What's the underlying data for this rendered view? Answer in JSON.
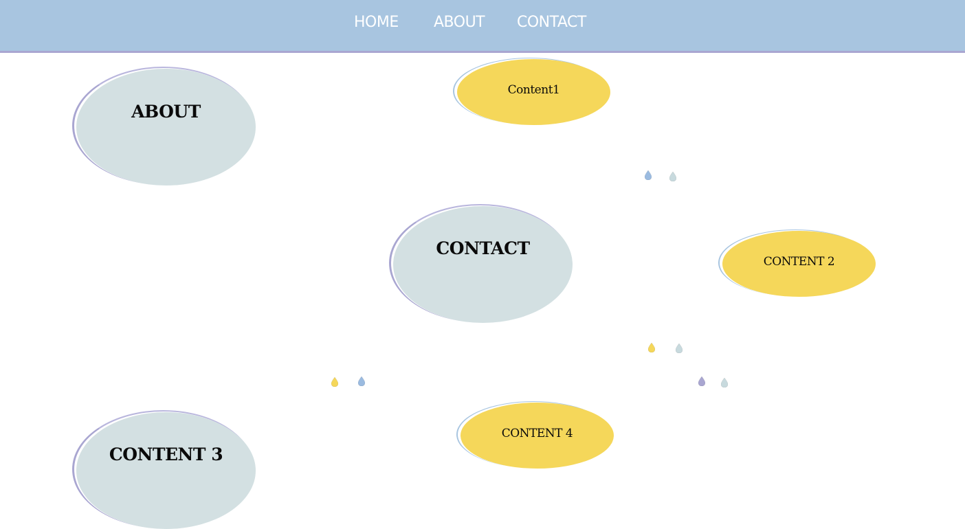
{
  "nav": {
    "items": [
      {
        "label": "HOME"
      },
      {
        "label": "ABOUT"
      },
      {
        "label": "CONTACT"
      }
    ]
  },
  "sections": {
    "about": {
      "label": "ABOUT"
    },
    "content1": {
      "label": "Content1"
    },
    "contact": {
      "label": "CONTACT"
    },
    "content2": {
      "label": "CONTENT 2"
    },
    "content3": {
      "label": "CONTENT 3"
    },
    "content4": {
      "label": "CONTENT 4"
    }
  },
  "colors": {
    "nav_background": "#a8c5e0",
    "nav_border": "#a9a6d1",
    "grey_blob": "#d3e0e2",
    "yellow_blob": "#f5d75a",
    "drop_blue": "#9bbbe0",
    "drop_grey": "#c8dade",
    "drop_yellow": "#f5d75a",
    "drop_purple": "#a9a6d1"
  },
  "decorations": {
    "drops": [
      {
        "icon": "drop-icon",
        "color": "#9bbbe0"
      },
      {
        "icon": "drop-icon",
        "color": "#c8dade"
      },
      {
        "icon": "drop-icon",
        "color": "#f5d75a"
      },
      {
        "icon": "drop-icon",
        "color": "#c8dade"
      },
      {
        "icon": "drop-icon",
        "color": "#f5d75a"
      },
      {
        "icon": "drop-icon",
        "color": "#9bbbe0"
      },
      {
        "icon": "drop-icon",
        "color": "#a9a6d1"
      },
      {
        "icon": "drop-icon",
        "color": "#c8dade"
      }
    ]
  }
}
